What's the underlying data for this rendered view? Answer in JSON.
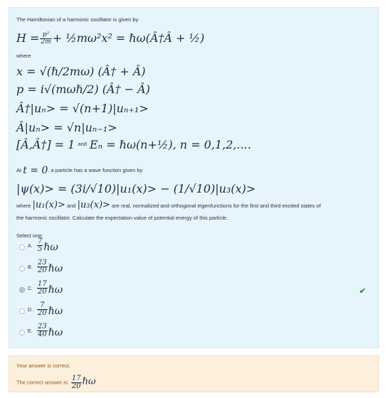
{
  "question": {
    "intro": "The Hamiltonian of a harmonic oscillator is given by",
    "where": "where",
    "at_prefix": "At",
    "at_eq": "t = 0",
    "at_suffix": ". a particle has a wave function given by",
    "where2": "where",
    "and": "and",
    "desc_line1": "are real, normalized and orthogonal eigenfunctions for the first and third excited states of",
    "desc_line2": "the harmonic oscillator. Calculate the expectation value of potential energy of this particle.",
    "select_one": "Select one:"
  },
  "equations": {
    "hamiltonian_lhs": "H =",
    "hamiltonian_num": "p²",
    "hamiltonian_den": "2m",
    "hamiltonian_rest": "+ ½mω²x² = ℏω(Â†Â + ½)",
    "x_eq": "x = √(ℏ/2mω) (Â† + Â)",
    "p_eq": "p = i√(mωℏ/2) (Â† − Â)",
    "raise_eq": "Â†|uₙ> = √(n+1)|uₙ₊₁>",
    "lower_eq": "Â|uₙ> = √n|uₙ₋₁>",
    "comm_eq": "[Â,Â†] = 1",
    "comm_and": "and",
    "energy_eq": "Eₙ = ℏω(n+½), n = 0,1,2,....",
    "psi_eq": "|ψ(x)> = (3i/√10)|u₁(x)> − (1/√10)|u₃(x)>",
    "u1": "|u₁(x)>",
    "u3": "|u₃(x)>"
  },
  "options": [
    {
      "letter": "A.",
      "num": "7",
      "den": "5",
      "unit": "ℏω",
      "selected": false
    },
    {
      "letter": "B.",
      "num": "23",
      "den": "20",
      "unit": "ℏω",
      "selected": false
    },
    {
      "letter": "C.",
      "num": "17",
      "den": "20",
      "unit": "ℏω",
      "selected": true
    },
    {
      "letter": "D.",
      "num": "7",
      "den": "20",
      "unit": "ℏω",
      "selected": false
    },
    {
      "letter": "E.",
      "num": "23",
      "den": "40",
      "unit": "ℏω",
      "selected": false
    }
  ],
  "feedback": {
    "status": "Your answer is correct.",
    "answer_label": "The correct answer is:",
    "answer_num": "17",
    "answer_den": "20",
    "answer_unit": "ℏω"
  },
  "colors": {
    "panel": "#e6f4fb",
    "feedback": "#fcefdc",
    "check": "#2e9a3a"
  }
}
